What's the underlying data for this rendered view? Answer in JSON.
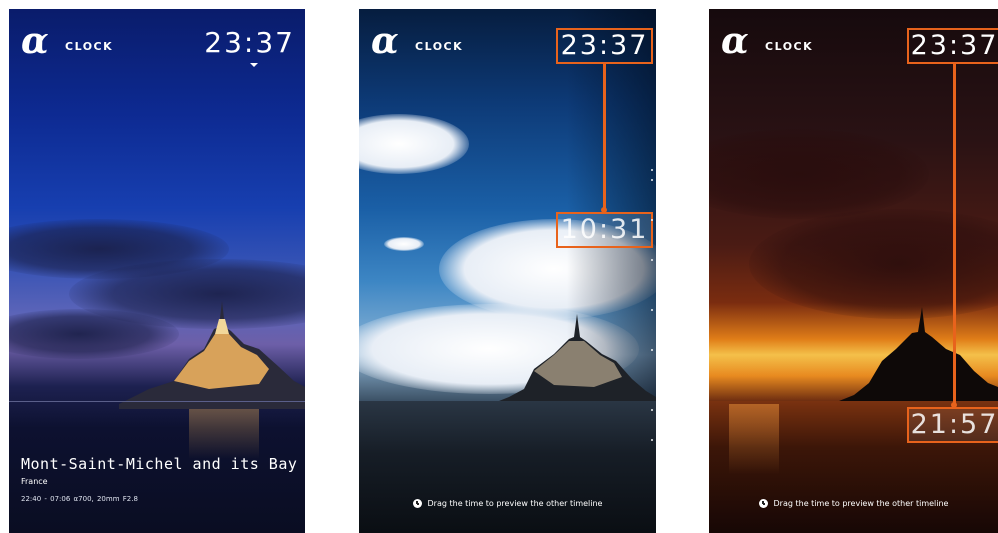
{
  "screens": [
    {
      "logo": "α",
      "brand": "CLOCK",
      "current_time": "23:37",
      "location": {
        "title": "Mont-Saint-Michel and its Bay",
        "country": "France",
        "photo_info": "22:40 - 07:06   α700, 20mm F2.8"
      }
    },
    {
      "logo": "α",
      "brand": "CLOCK",
      "current_time": "23:37",
      "preview_time": "10:31",
      "hint": "Drag the time to preview the other timeline"
    },
    {
      "logo": "α",
      "brand": "CLOCK",
      "current_time": "23:37",
      "preview_time": "21:57",
      "hint": "Drag the time to preview the other timeline"
    }
  ],
  "colors": {
    "accent": "#e8631c",
    "text": "#ffffff"
  },
  "icons": [
    "clock-icon",
    "alpha-logo",
    "chevron-down-icon"
  ]
}
